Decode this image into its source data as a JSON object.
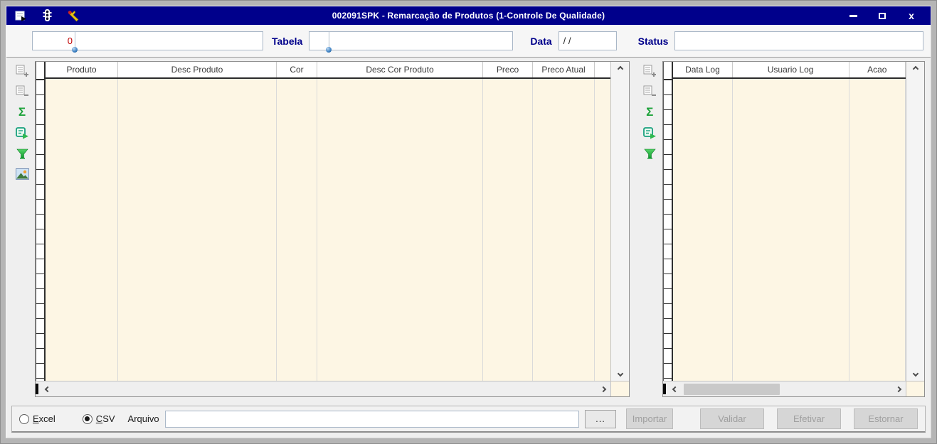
{
  "titlebar": {
    "title": "002091SPK - Remarcação de Produtos (1-Controle De Qualidade)",
    "close_glyph": "x"
  },
  "form": {
    "code_value": "0",
    "code_desc_value": "",
    "tabela_label": "Tabela",
    "tabela_code_value": "",
    "tabela_desc_value": "",
    "data_label": "Data",
    "data_value": "/ /",
    "status_label": "Status",
    "status_value": ""
  },
  "grid_toolbar": {
    "sum_glyph": "Σ",
    "left_icons": [
      "add-record",
      "remove-record",
      "sum",
      "export-grid",
      "filter",
      "image"
    ],
    "right_icons": [
      "add-record",
      "remove-record",
      "sum",
      "export-grid",
      "filter"
    ]
  },
  "products_grid": {
    "columns": [
      "Produto",
      "Desc Produto",
      "Cor",
      "Desc Cor Produto",
      "Preco",
      "Preco Atual"
    ],
    "rows": []
  },
  "log_grid": {
    "columns": [
      "Data Log",
      "Usuario Log",
      "Acao"
    ],
    "rows": []
  },
  "footer": {
    "excel_label": "Excel",
    "csv_label": "CSV",
    "selected_format": "CSV",
    "arquivo_label": "Arquivo",
    "arquivo_value": "",
    "arquivo_placeholder": "",
    "browse_label": "...",
    "importar_label": "Importar",
    "validar_label": "Validar",
    "efetivar_label": "Efetivar",
    "estornar_label": "Estornar"
  },
  "colors": {
    "titlebar_bg": "#00008b",
    "label_navy": "#00008b",
    "grid_body_bg": "#fdf6e4",
    "value_red": "#c00000",
    "icon_green": "#1fa33c",
    "window_bg": "#efefef"
  }
}
